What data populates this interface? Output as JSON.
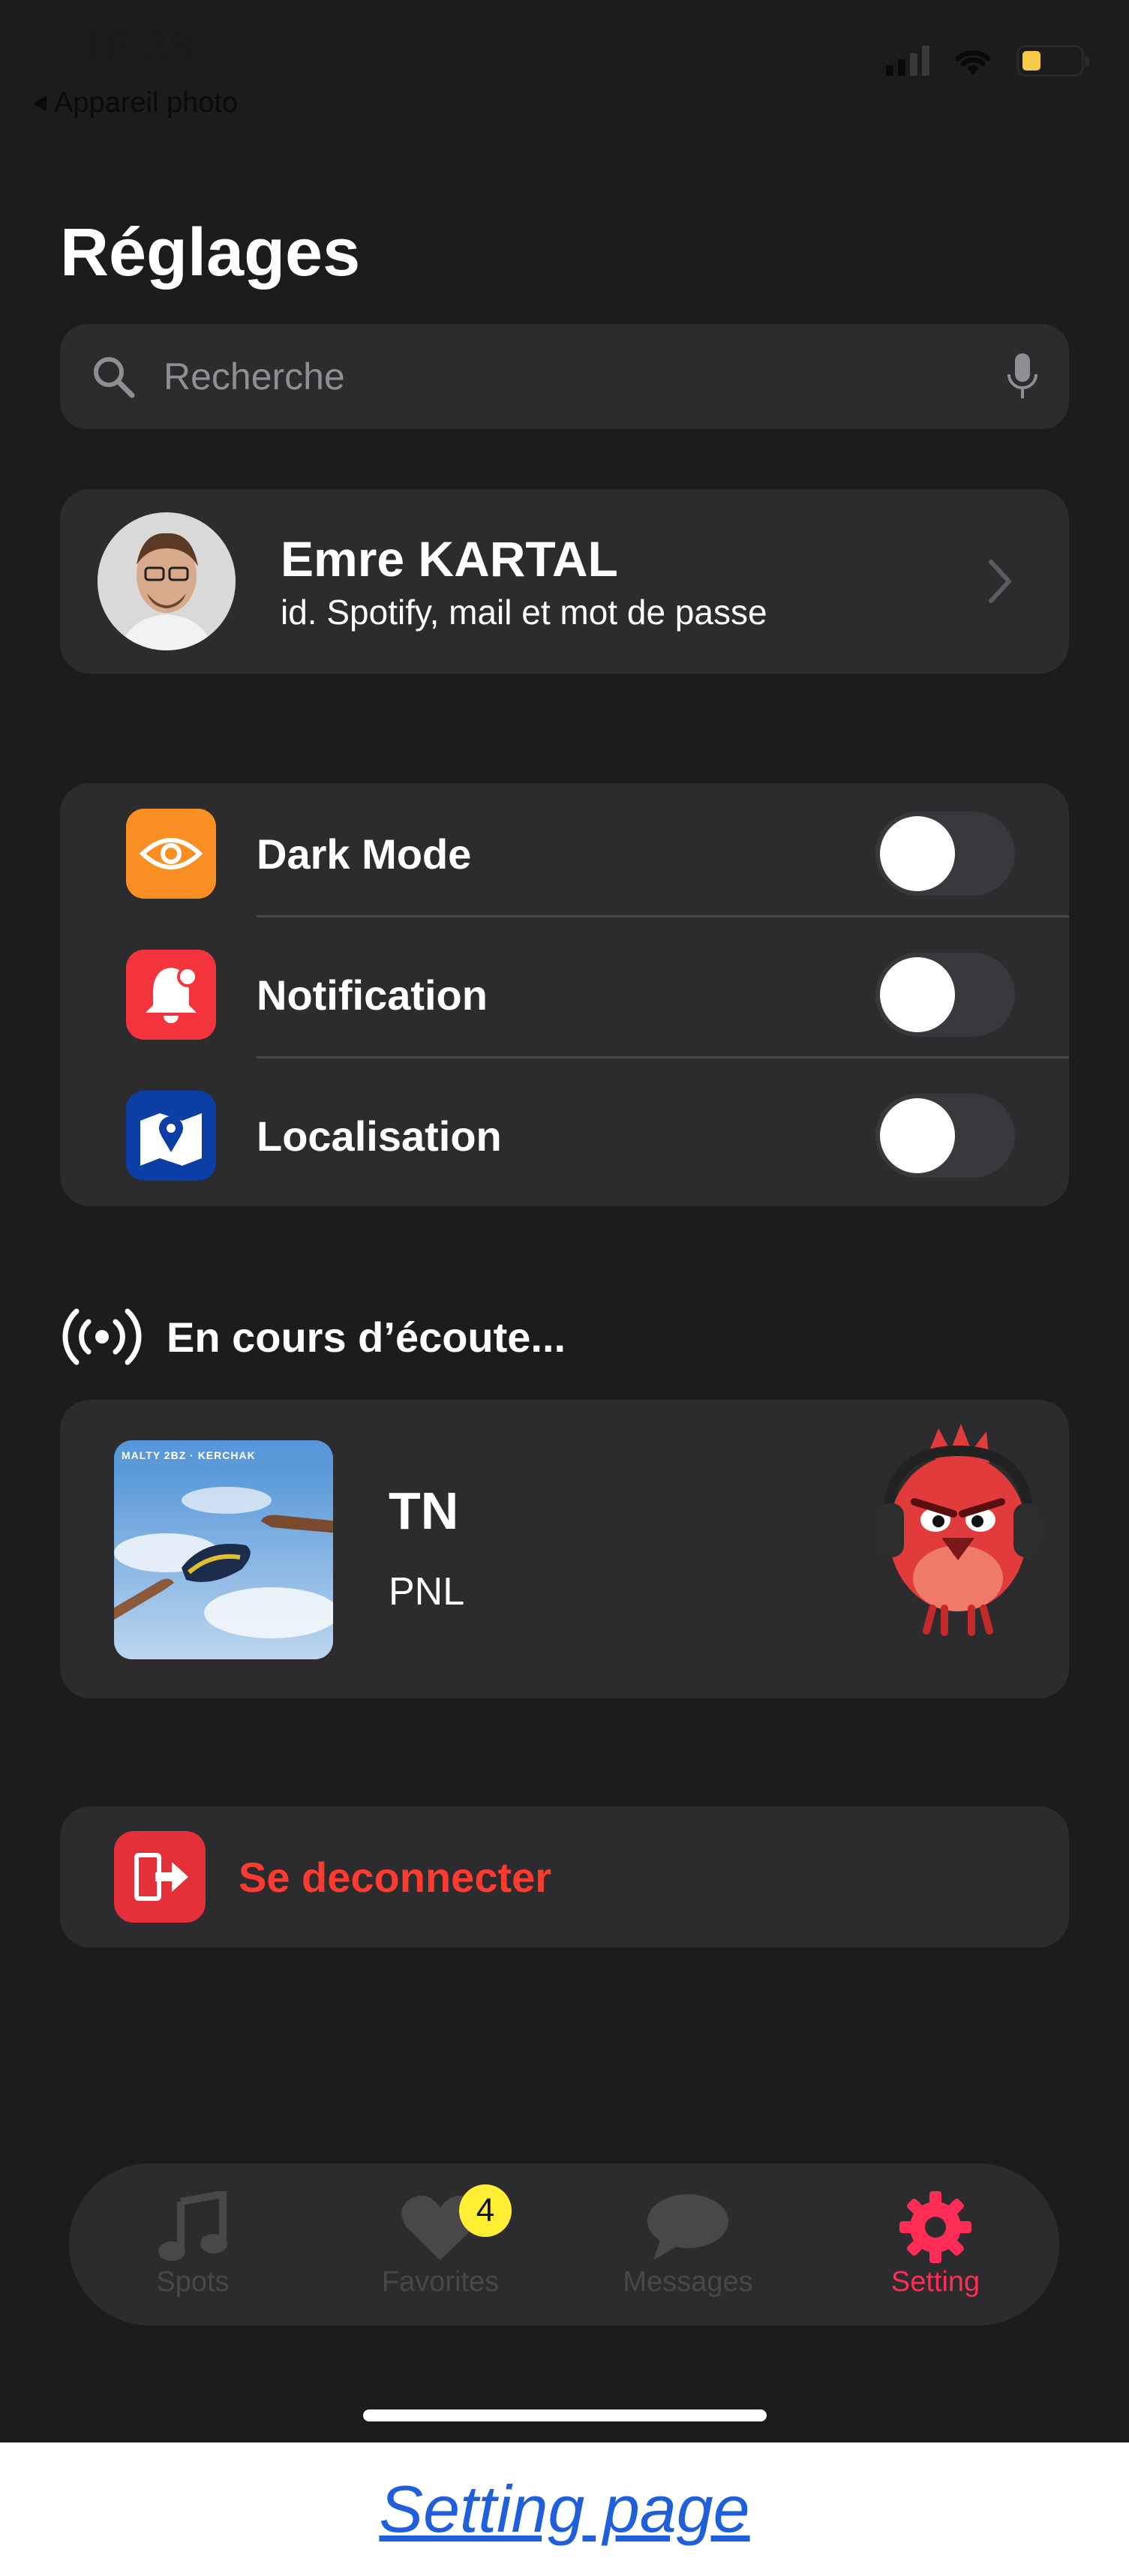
{
  "status_bar": {
    "time": "16:38",
    "back_label": "Appareil photo"
  },
  "header": {
    "title": "Réglages"
  },
  "search": {
    "placeholder": "Recherche",
    "icon": "magnifier-icon",
    "voice_icon": "microphone-icon"
  },
  "profile": {
    "name": "Emre KARTAL",
    "subtitle": "id. Spotify, mail et mot de passe"
  },
  "settings": {
    "items": [
      {
        "label": "Dark Mode",
        "icon": "eye-icon",
        "icon_color": "#f98f23",
        "enabled": false
      },
      {
        "label": "Notification",
        "icon": "bell-icon",
        "icon_color": "#f4343d",
        "enabled": false
      },
      {
        "label": "Localisation",
        "icon": "map-icon",
        "icon_color": "#0b3fa6",
        "enabled": false
      }
    ]
  },
  "now_playing": {
    "heading": "En cours d’écoute...",
    "title": "TN",
    "artist": "PNL",
    "cover_text": "MALTY 2BZ · KERCHAK"
  },
  "logout": {
    "label": "Se deconnecter",
    "icon_color": "#e5303a"
  },
  "tabbar": {
    "tabs": [
      {
        "label": "Spots",
        "icon": "music-note-icon",
        "active": false
      },
      {
        "label": "Favorites",
        "icon": "heart-icon",
        "active": false,
        "badge": "4"
      },
      {
        "label": "Messages",
        "icon": "chat-bubble-icon",
        "active": false
      },
      {
        "label": "Setting",
        "icon": "gear-icon",
        "active": true
      }
    ],
    "active_color": "#ff2d55"
  },
  "caption": {
    "text": "Setting page"
  }
}
